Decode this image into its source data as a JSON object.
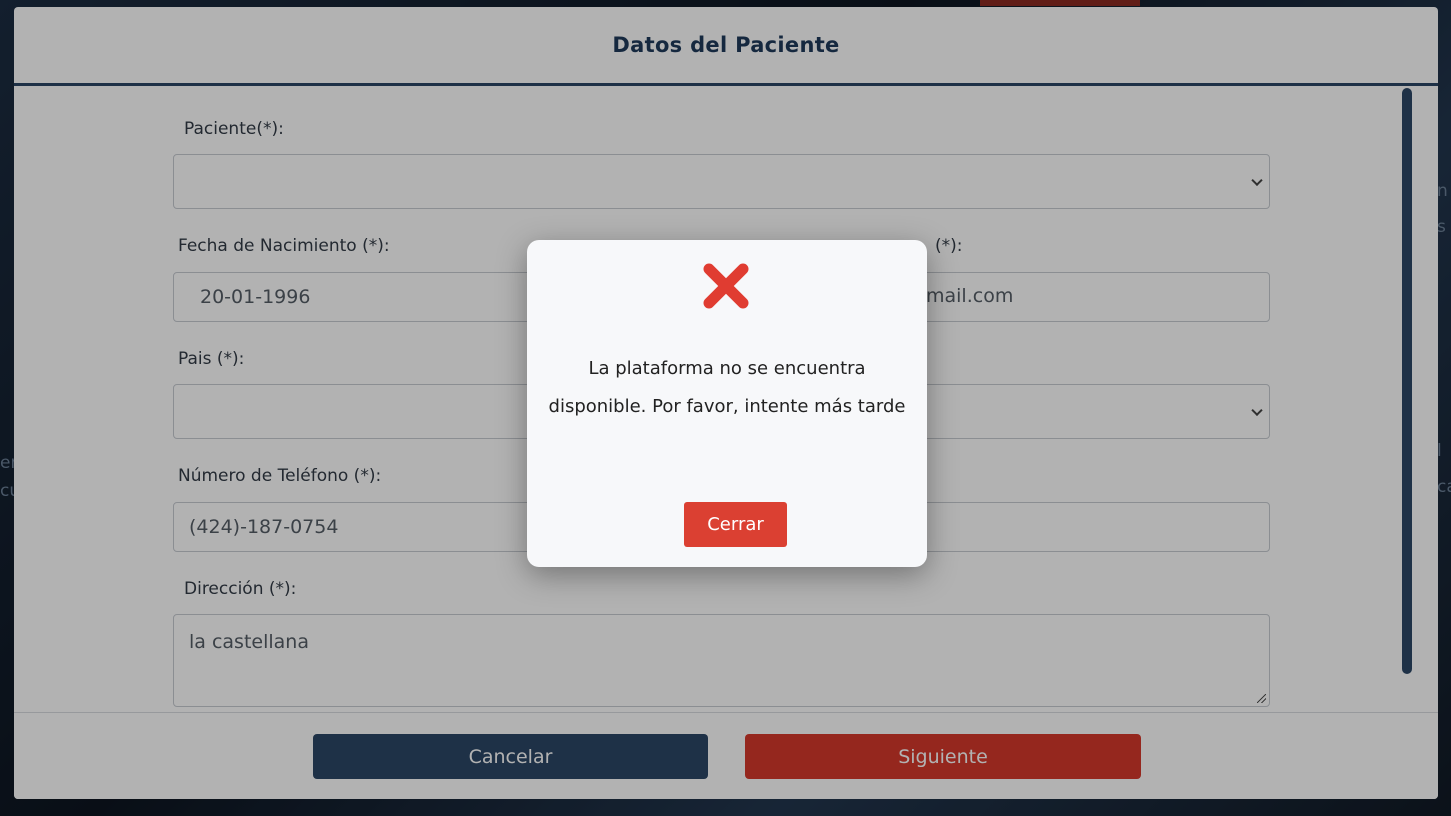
{
  "background": {
    "left_fragments": [
      "en",
      "cu"
    ],
    "right_fragments": [
      "n",
      "s",
      "l",
      "ca"
    ]
  },
  "modal": {
    "title": "Datos del Paciente",
    "fields": {
      "patient": {
        "label": "Paciente(*):",
        "value": ""
      },
      "birthdate": {
        "label": "Fecha de Nacimiento (*):",
        "value": "20-01-1996"
      },
      "email": {
        "label_visible": "(*):",
        "value_visible": "mail.com"
      },
      "country": {
        "label": "Pais (*):",
        "value": ""
      },
      "phone": {
        "label": "Número de Teléfono (*):",
        "value": "(424)-187-0754"
      },
      "address": {
        "label": "Dirección (*):",
        "value": "la castellana"
      }
    },
    "buttons": {
      "cancel": "Cancelar",
      "next": "Siguiente"
    }
  },
  "alert": {
    "icon": "error-x-icon",
    "message": "La plataforma no se encuentra disponible. Por favor, intente más tarde",
    "close_label": "Cerrar"
  },
  "colors": {
    "primary_navy": "#2b4766",
    "danger_red": "#d6392c",
    "alert_x_red": "#e03c31"
  }
}
